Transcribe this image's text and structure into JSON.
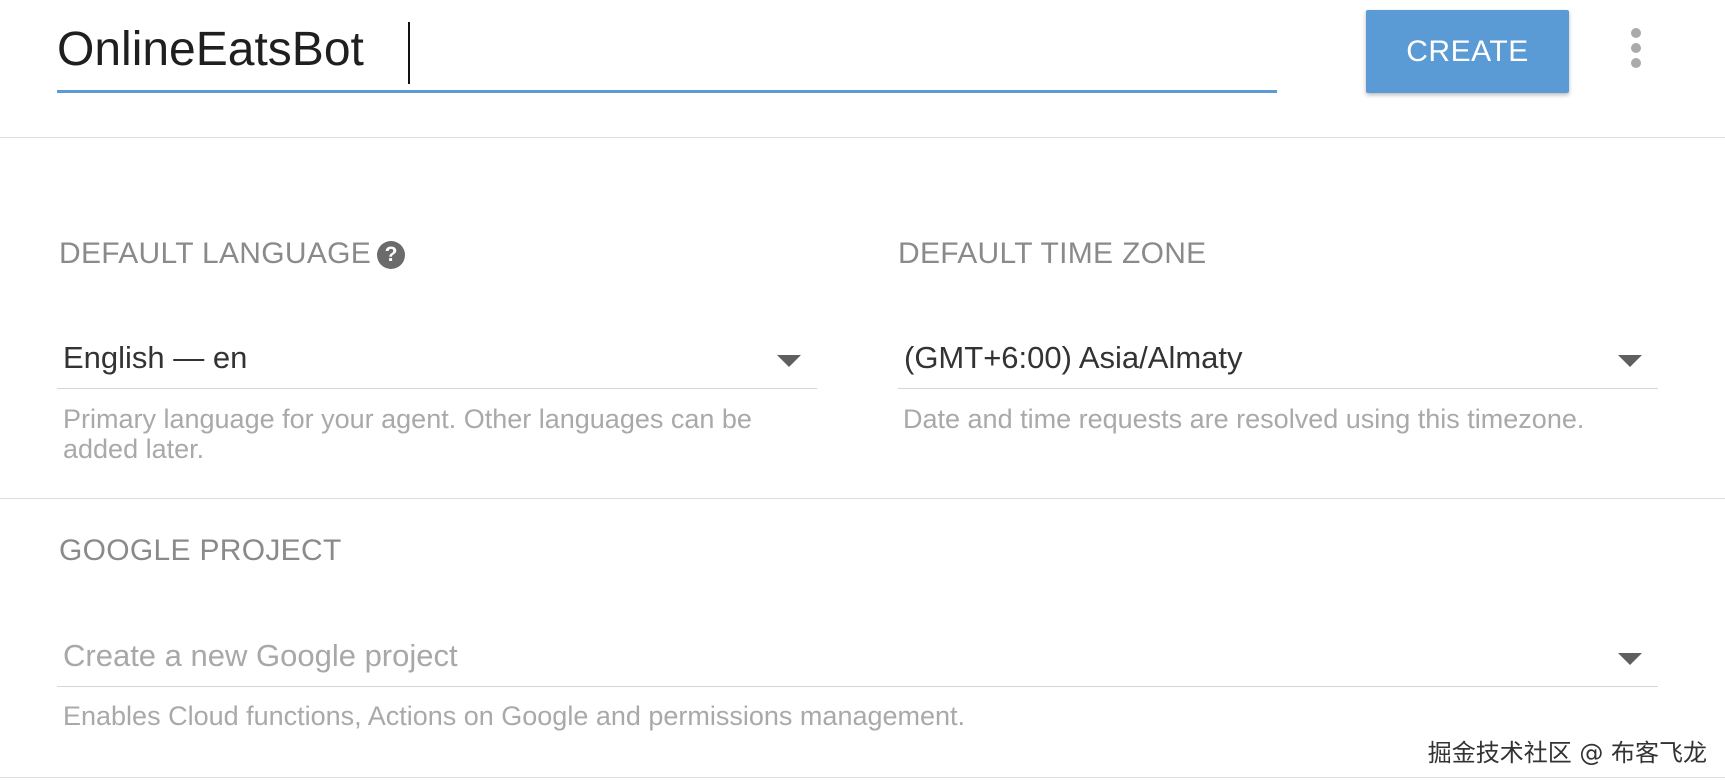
{
  "header": {
    "agent_name_value": "OnlineEatsBot",
    "create_label": "CREATE",
    "more_menu_icon": "more-vert-icon"
  },
  "language": {
    "label": "DEFAULT LANGUAGE",
    "help_icon_glyph": "?",
    "selected": "English — en",
    "hint": "Primary language for your agent. Other languages can be added later."
  },
  "timezone": {
    "label": "DEFAULT TIME ZONE",
    "selected": "(GMT+6:00) Asia/Almaty",
    "hint": "Date and time requests are resolved using this timezone."
  },
  "google_project": {
    "label": "GOOGLE PROJECT",
    "placeholder": "Create a new Google project",
    "hint": "Enables Cloud functions, Actions on Google and permissions management."
  },
  "watermark": "掘金技术社区 @ 布客飞龙",
  "colors": {
    "accent": "#5b9bd5",
    "label_gray": "#8a8a8a",
    "hint_gray": "#a9a9a9"
  }
}
